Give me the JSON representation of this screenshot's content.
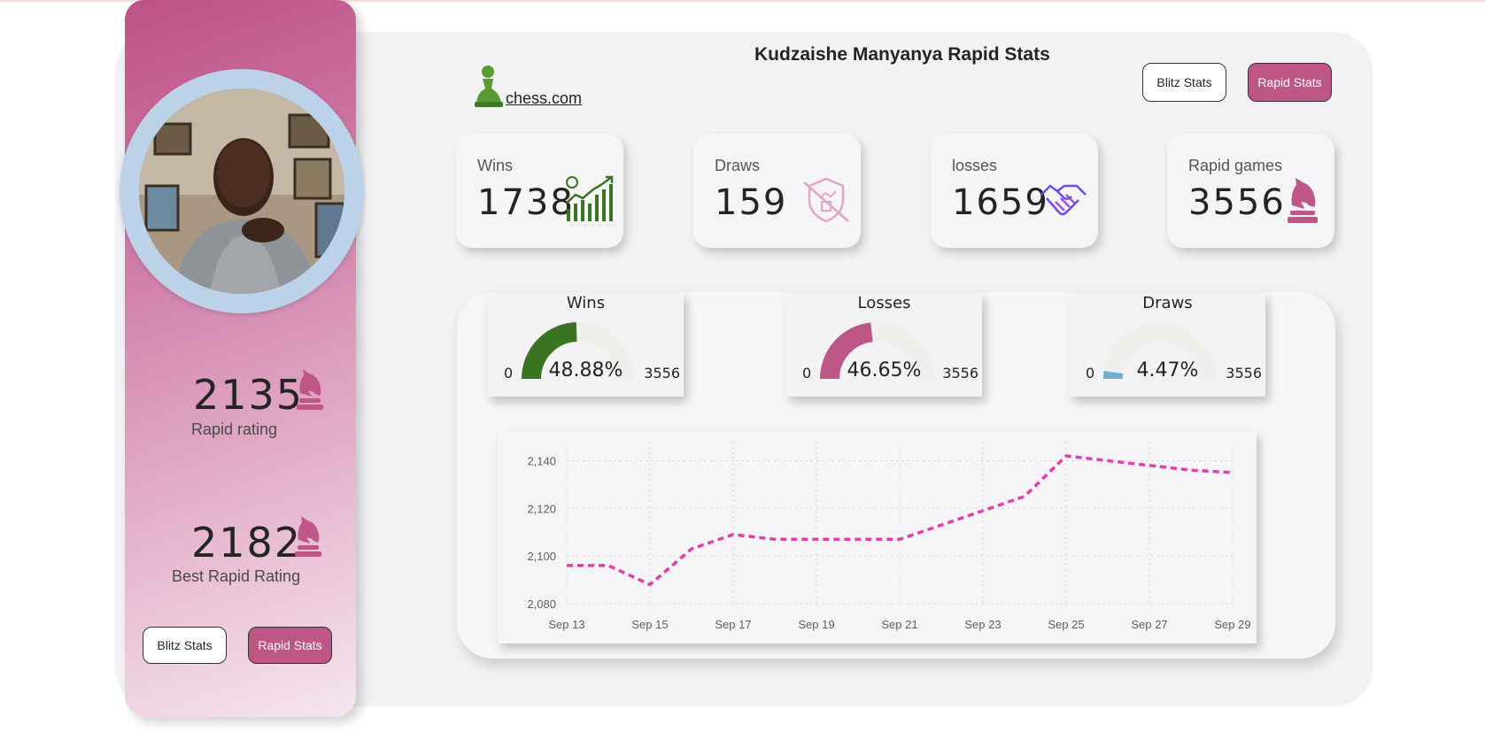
{
  "header": {
    "title": "Kudzaishe Manyanya Rapid Stats",
    "logo_text": "chess.com",
    "blitz_button": "Blitz Stats",
    "rapid_button": "Rapid Stats"
  },
  "sidebar": {
    "rapid_rating_value": "2135",
    "rapid_rating_label": "Rapid rating",
    "best_rating_value": "2182",
    "best_rating_label": "Best Rapid Rating",
    "blitz_button": "Blitz Stats",
    "rapid_button": "Rapid Stats"
  },
  "kpis": [
    {
      "label": "Wins",
      "value": "1738",
      "icon": "chart-growth-icon"
    },
    {
      "label": "Draws",
      "value": "159",
      "icon": "shield-draw-icon"
    },
    {
      "label": "losses",
      "value": "1659",
      "icon": "handshake-icon"
    },
    {
      "label": "Rapid games",
      "value": "3556",
      "icon": "chess-knight-icon"
    }
  ],
  "gauges": [
    {
      "title": "Wins",
      "min": "0",
      "max": "3556",
      "value_label": "48.88%",
      "fraction": 0.4888,
      "color": "#3a7422"
    },
    {
      "title": "Losses",
      "min": "0",
      "max": "3556",
      "value_label": "46.65%",
      "fraction": 0.4665,
      "color": "#be5787"
    },
    {
      "title": "Draws",
      "min": "0",
      "max": "3556",
      "value_label": "4.47%",
      "fraction": 0.0447,
      "color": "#6fadd3"
    }
  ],
  "colors": {
    "accent": "#be5787",
    "line": "#e040a8",
    "wins": "#3a7422",
    "draws": "#6fadd3"
  },
  "chart_data": {
    "type": "line",
    "x": [
      "Sep 13",
      "Sep 14",
      "Sep 15",
      "Sep 16",
      "Sep 17",
      "Sep 18",
      "Sep 19",
      "Sep 20",
      "Sep 21",
      "Sep 22",
      "Sep 23",
      "Sep 24",
      "Sep 25",
      "Sep 26",
      "Sep 27",
      "Sep 28",
      "Sep 29"
    ],
    "x_ticks": [
      "Sep 13",
      "Sep 15",
      "Sep 17",
      "Sep 19",
      "Sep 21",
      "Sep 23",
      "Sep 25",
      "Sep 27",
      "Sep 29"
    ],
    "series": [
      {
        "values": [
          2096,
          2096,
          2088,
          2103,
          2109,
          2107,
          2107,
          2107,
          2107,
          2113,
          2119,
          2125,
          2142,
          2140,
          2138,
          2136,
          2135
        ]
      }
    ],
    "y_ticks": [
      "2,080",
      "2,100",
      "2,120",
      "2,140"
    ],
    "ylim": [
      2080,
      2145
    ],
    "grid": true,
    "line_style": "dashed"
  }
}
